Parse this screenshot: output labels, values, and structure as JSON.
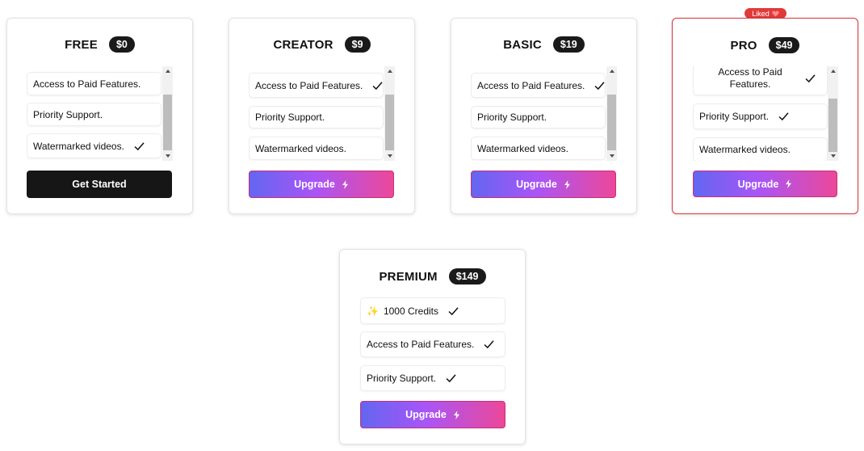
{
  "plans": [
    {
      "name": "FREE",
      "price": "$0",
      "features": [
        "Access to Paid Features.",
        "Priority Support.",
        "Watermarked videos."
      ],
      "button": "Get Started"
    },
    {
      "name": "CREATOR",
      "price": "$9",
      "features": [
        "Access to Paid Features.",
        "Priority Support.",
        "Watermarked videos."
      ],
      "button": "Upgrade"
    },
    {
      "name": "BASIC",
      "price": "$19",
      "features": [
        "Access to Paid Features.",
        "Priority Support.",
        "Watermarked videos."
      ],
      "button": "Upgrade"
    },
    {
      "name": "PRO",
      "price": "$49",
      "badge": "Liked",
      "features": [
        "Access to Paid Features.",
        "Priority Support.",
        "Watermarked videos."
      ],
      "button": "Upgrade"
    },
    {
      "name": "PREMIUM",
      "price": "$149",
      "features": [
        "1000 Credits",
        "Access to Paid Features.",
        "Priority Support."
      ],
      "button": "Upgrade"
    }
  ],
  "icons": {
    "check": "check-icon",
    "bolt": "lightning-bolt-icon",
    "heart": "heart-icon",
    "sparkle": "sparkles-icon"
  },
  "colors": {
    "gradient_start": "#6366f1",
    "gradient_mid": "#a855f7",
    "gradient_end": "#ec4899",
    "dark_button": "#161616",
    "liked_border": "#d9363e",
    "liked_badge": "#e03a3a"
  }
}
